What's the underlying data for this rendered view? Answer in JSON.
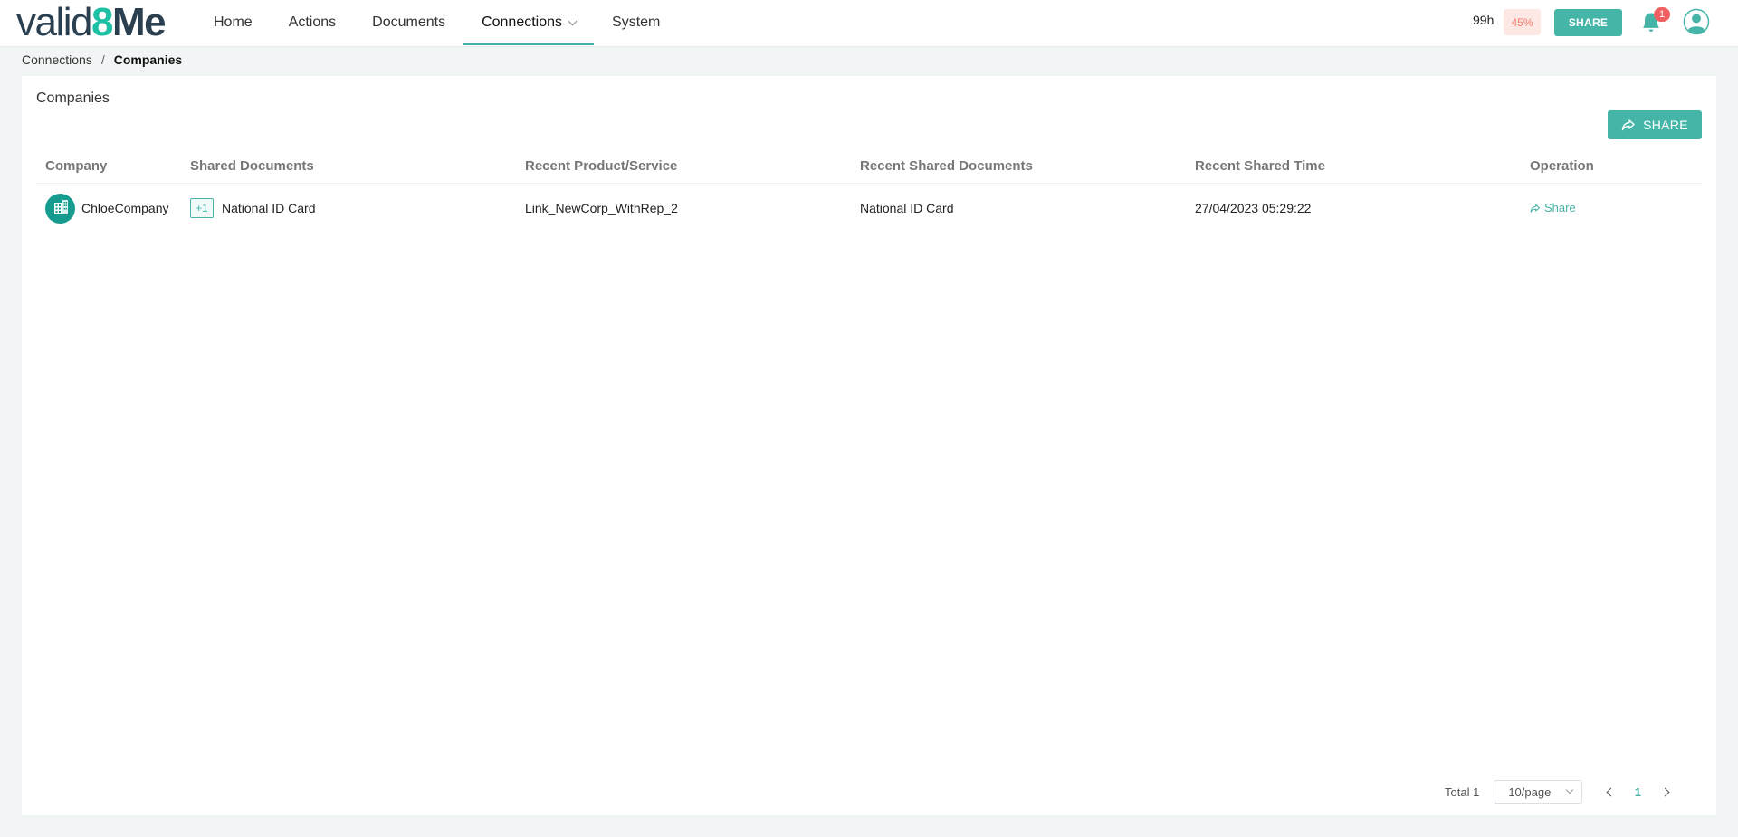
{
  "header": {
    "logo": {
      "part1": "valid",
      "part2": "8",
      "part3": "Me"
    },
    "nav": [
      {
        "label": "Home"
      },
      {
        "label": "Actions"
      },
      {
        "label": "Documents"
      },
      {
        "label": "Connections",
        "active": true,
        "has_dropdown": true
      },
      {
        "label": "System"
      }
    ],
    "hours": "99h",
    "progress_percent": "45%",
    "share_label": "SHARE",
    "notification_count": "1",
    "icons": {
      "bell": "bell-icon",
      "avatar": "user-avatar-icon",
      "dropdown": "chevron-down-icon"
    }
  },
  "breadcrumb": {
    "parent": "Connections",
    "separator": "/",
    "current": "Companies"
  },
  "main": {
    "title": "Companies",
    "share_button_label": "SHARE",
    "table": {
      "columns": [
        "Company",
        "Shared Documents",
        "Recent Product/Service",
        "Recent Shared Documents",
        "Recent Shared Time",
        "Operation"
      ],
      "rows": [
        {
          "company": "ChloeCompany",
          "shared_docs_extra": "+1",
          "shared_docs": "National ID Card",
          "recent_product": "Link_NewCorp_WithRep_2",
          "recent_docs": "National ID Card",
          "recent_time": "27/04/2023 05:29:22",
          "operation": "Share"
        }
      ]
    },
    "pagination": {
      "total": "Total 1",
      "page_size": "10/page",
      "current_page": "1"
    }
  },
  "colors": {
    "accent": "#45b5a8",
    "logo_dark": "#2a3f4f",
    "logo_teal": "#1fc1a4",
    "badge": "#f06060",
    "percent_bg": "#fde8e4",
    "percent_text": "#f07a6a"
  }
}
